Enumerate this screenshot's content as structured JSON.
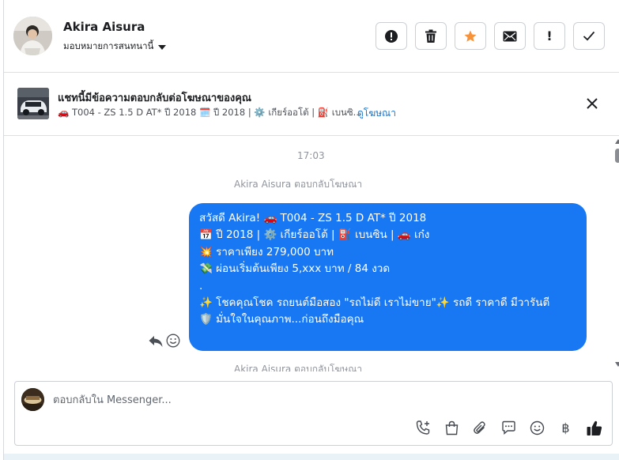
{
  "header": {
    "name": "Akira Aisura",
    "assign_label": "มอบหมายการสนทนานี้",
    "actions": [
      {
        "icon": "alert-circle-icon",
        "label": ""
      },
      {
        "icon": "trash-icon",
        "label": ""
      },
      {
        "icon": "star-icon",
        "label": ""
      },
      {
        "icon": "envelope-icon",
        "label": ""
      },
      {
        "icon": "exclamation-icon",
        "label": "!"
      },
      {
        "icon": "checkmark-icon",
        "label": ""
      }
    ]
  },
  "ad": {
    "title": "แชทนี้มีข้อความตอบกลับต่อโฆษณาของคุณ",
    "subtitle": "🚗 T004 - ZS 1.5 D AT* ปี 2018 🗓️ ปี 2018 | ⚙️ เกียร์ออโต้ | ⛽ เบนซิ...",
    "link": "ดูโฆษณา"
  },
  "conversation": {
    "time": "17:03",
    "replied_label": "Akira Aisura ตอบกลับโฆษณา",
    "replied_label_2": "Akira Aisura ตอบกลับโฆษณา",
    "message_lines": [
      "สวัสดี Akira! 🚗 T004 - ZS 1.5 D AT* ปี 2018",
      "📅 ปี 2018 | ⚙️ เกียร์ออโต้ | ⛽ เบนซิน | 🚗 เก๋ง",
      "💥 ราคาเพียง 279,000 บาท",
      "💸 ผ่อนเริ่มต้นเพียง 5,xxx บาท / 84 งวด",
      ".",
      "✨ โชคคุณโชค รถยนต์มือสอง \"รถไม่ดี เราไม่ขาย\"✨ รถดี ราคาดี มีวารันตี",
      "🛡️ มั่นใจในคุณภาพ...ก่อนถึงมือคุณ"
    ]
  },
  "composer": {
    "placeholder": "ตอบกลับใน Messenger...",
    "tools": [
      "phone-plus-icon",
      "shopping-bag-icon",
      "paperclip-icon",
      "chat-bubble-icon",
      "smiley-icon",
      "baht-icon",
      "thumbs-up-icon"
    ],
    "baht_symbol": "฿"
  },
  "colors": {
    "accent": "#1877f2",
    "star": "#f7923a",
    "link": "#1a73c8"
  }
}
